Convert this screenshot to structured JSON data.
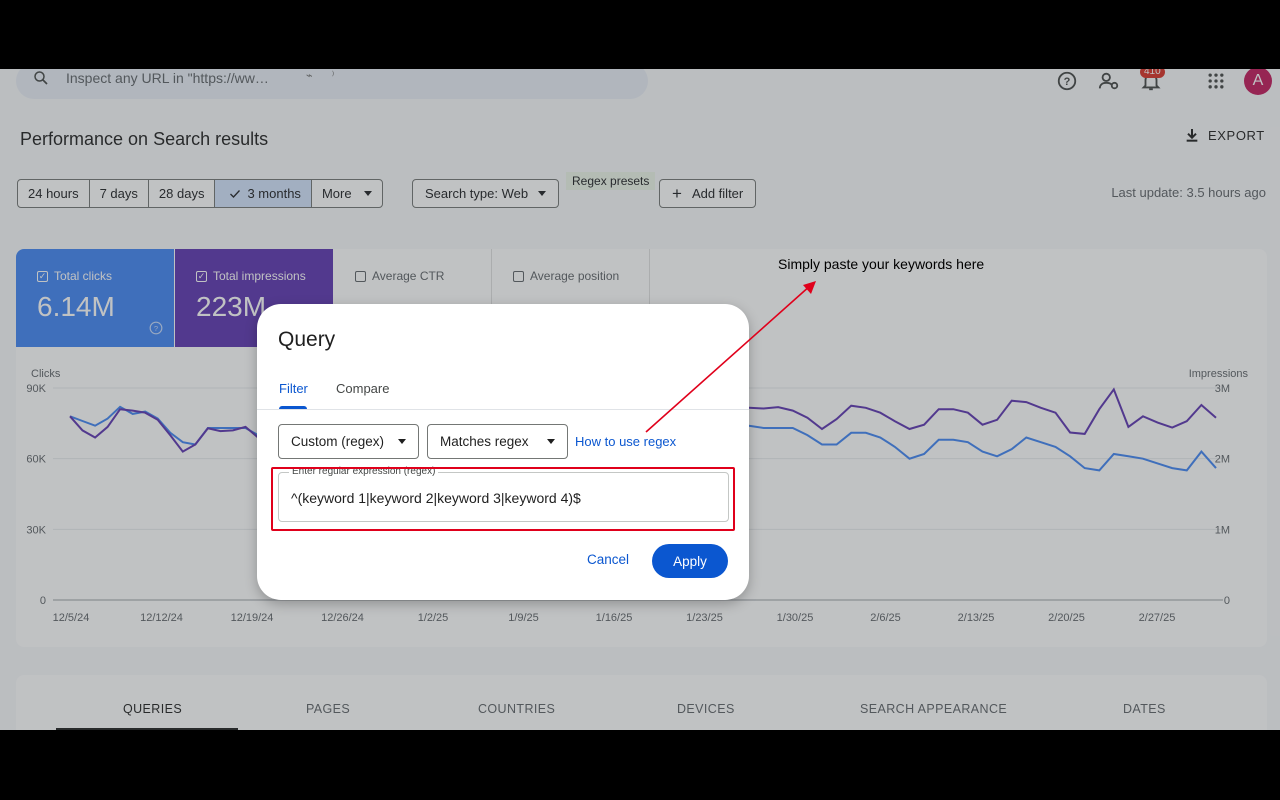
{
  "header": {
    "search_placeholder": "Inspect any URL in \"https://ww…",
    "notification_count": "410",
    "avatar_letter": "A"
  },
  "page": {
    "title": "Performance on Search results",
    "export_label": "EXPORT"
  },
  "toolbar": {
    "date_ranges": [
      "24 hours",
      "7 days",
      "28 days",
      "3 months",
      "More"
    ],
    "selected_range": "3 months",
    "search_type": "Search type: Web",
    "regex_presets_label": "Regex presets",
    "add_filter": "Add filter",
    "last_update": "Last update: 3.5 hours ago"
  },
  "metrics": {
    "clicks": {
      "label": "Total clicks",
      "value": "6.14M"
    },
    "impressions": {
      "label": "Total impressions",
      "value": "223M"
    },
    "ctr": {
      "label": "Average CTR"
    },
    "position": {
      "label": "Average position"
    }
  },
  "chart_data": {
    "type": "line",
    "ylabel": "Clicks",
    "y2label": "Impressions",
    "y_ticks": [
      "0",
      "30K",
      "60K",
      "90K"
    ],
    "y2_ticks": [
      "0",
      "1M",
      "2M",
      "3M"
    ],
    "ylim": [
      0,
      90000
    ],
    "y2lim": [
      0,
      3000000
    ],
    "x_ticks": [
      "12/5/24",
      "12/12/24",
      "12/19/24",
      "12/26/24",
      "1/2/25",
      "1/9/25",
      "1/16/25",
      "1/23/25",
      "1/30/25",
      "2/6/25",
      "2/13/25",
      "2/20/25",
      "2/27/25"
    ],
    "series": [
      {
        "name": "Clicks",
        "color": "#4285f4",
        "axis": "left",
        "visible_left_values": [
          78000,
          76000,
          74000,
          77000,
          82000,
          79000,
          80000,
          77000,
          71000,
          67000,
          66000,
          73000,
          73000,
          73000,
          73000,
          70000
        ],
        "visible_right_values": [
          74000,
          73000,
          73000,
          73000,
          70000,
          66000,
          66000,
          71000,
          71000,
          69000,
          65000,
          60000,
          62000,
          68000,
          68000,
          67000,
          63000,
          61000,
          64000,
          69000,
          67000,
          65000,
          61000,
          56000,
          55000,
          62000,
          61000,
          60000,
          58000,
          56000,
          55000,
          63000,
          56000
        ]
      },
      {
        "name": "Impressions",
        "color": "#5e35b1",
        "axis": "right",
        "visible_left_values": [
          2600000,
          2400000,
          2300000,
          2450000,
          2700000,
          2680000,
          2650000,
          2550000,
          2330000,
          2100000,
          2200000,
          2430000,
          2390000,
          2400000,
          2450000,
          2300000
        ],
        "visible_right_values": [
          2720000,
          2710000,
          2730000,
          2680000,
          2580000,
          2420000,
          2560000,
          2750000,
          2720000,
          2650000,
          2530000,
          2420000,
          2480000,
          2700000,
          2700000,
          2650000,
          2480000,
          2550000,
          2820000,
          2800000,
          2720000,
          2650000,
          2370000,
          2350000,
          2700000,
          2980000,
          2450000,
          2600000,
          2510000,
          2440000,
          2530000,
          2760000,
          2580000
        ]
      }
    ]
  },
  "tabs": [
    "QUERIES",
    "PAGES",
    "COUNTRIES",
    "DEVICES",
    "SEARCH APPEARANCE",
    "DATES"
  ],
  "dialog": {
    "title": "Query",
    "tabs": [
      "Filter",
      "Compare"
    ],
    "filter_type": "Custom (regex)",
    "match_type": "Matches regex",
    "help_link": "How to use regex",
    "field_label": "Enter regular expression (regex)",
    "field_value": "^(keyword 1|keyword 2|keyword 3|keyword 4)$",
    "cancel": "Cancel",
    "apply": "Apply"
  },
  "annotation": {
    "text": "Simply paste your keywords here",
    "color": "#e0001b"
  }
}
